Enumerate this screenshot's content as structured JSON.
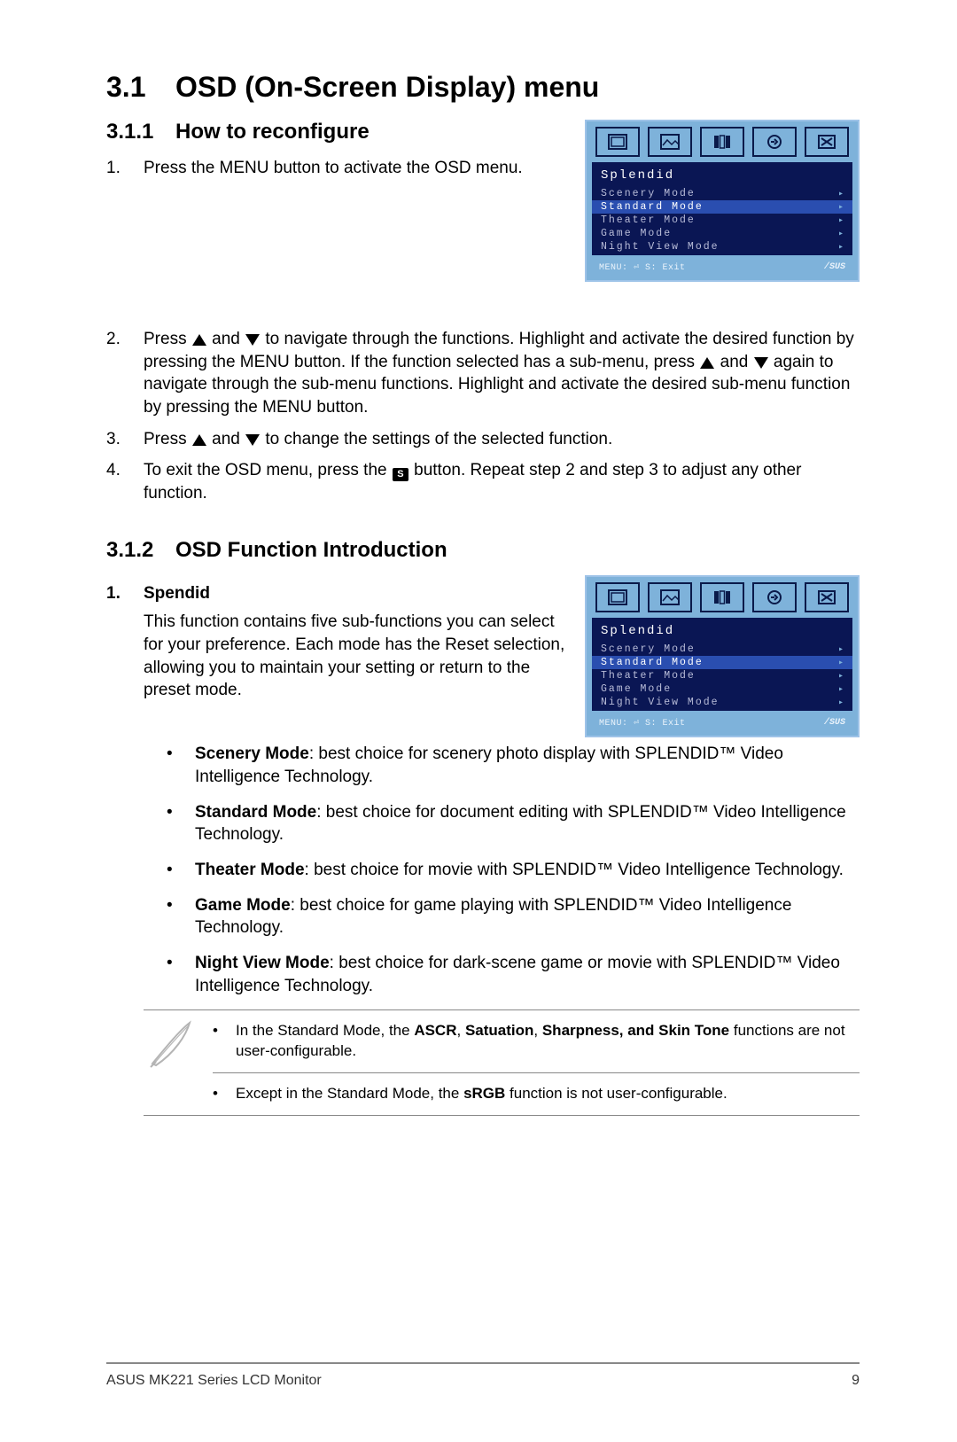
{
  "section": {
    "num": "3.1",
    "title": "OSD (On-Screen Display) menu"
  },
  "sub1": {
    "num": "3.1.1",
    "title": "How to reconfigure"
  },
  "sub2": {
    "num": "3.1.2",
    "title": "OSD Function Introduction"
  },
  "steps": {
    "s1": {
      "num": "1.",
      "text": "Press the MENU button to activate the OSD menu."
    },
    "s2": {
      "num": "2.",
      "a": "Press ",
      "b": " and ",
      "c": " to navigate through the functions. Highlight and activate the desired function by pressing the MENU button. If the function selected has a sub-menu, press ",
      "d": " and ",
      "e": " again to navigate through the sub-menu functions. Highlight and activate the desired sub-menu function by pressing the MENU button."
    },
    "s3": {
      "num": "3.",
      "a": "Press ",
      "b": " and ",
      "c": " to change the settings of the selected function."
    },
    "s4": {
      "num": "4.",
      "a": "To exit the OSD menu, press the ",
      "b": " button. Repeat step 2 and step 3 to adjust any other function."
    }
  },
  "spendid": {
    "num": "1.",
    "title": "Spendid",
    "desc": "This function contains five sub-functions you can select for your preference. Each mode has the Reset selection, allowing you to maintain your setting or return to the preset mode."
  },
  "modes": {
    "m1": {
      "b": "Scenery Mode",
      "t": ": best choice for scenery photo display with SPLENDID™ Video Intelligence Technology."
    },
    "m2": {
      "b": "Standard Mode",
      "t": ": best choice for document editing with SPLENDID™ Video Intelligence Technology."
    },
    "m3": {
      "b": "Theater Mode",
      "t": ": best choice for movie with SPLENDID™ Video Intelligence Technology."
    },
    "m4": {
      "b": "Game Mode",
      "t": ": best choice for game playing with SPLENDID™ Video Intelligence Technology."
    },
    "m5": {
      "b": "Night View Mode",
      "t": ": best choice for dark-scene game or movie with SPLENDID™ Video Intelligence Technology."
    }
  },
  "notes": {
    "n1": {
      "a": "In the Standard Mode, the ",
      "b": "ASCR",
      "c": ", ",
      "d": "Satuation",
      "e": ", ",
      "f": "Sharpness, and Skin Tone",
      "g": " functions are not user-configurable."
    },
    "n2": {
      "a": "Except in the Standard Mode, the ",
      "b": "sRGB",
      "c": " function is not user-configurable."
    }
  },
  "osd": {
    "header": "Splendid",
    "items": [
      "Scenery Mode",
      "Standard Mode",
      "Theater Mode",
      "Game Mode",
      "Night View Mode"
    ],
    "footer_left": "MENU: ⏎   S: Exit",
    "brand": "/SUS"
  },
  "footer": {
    "left": "ASUS MK221 Series LCD Monitor",
    "right": "9"
  },
  "icons": {
    "s_label": "S"
  }
}
